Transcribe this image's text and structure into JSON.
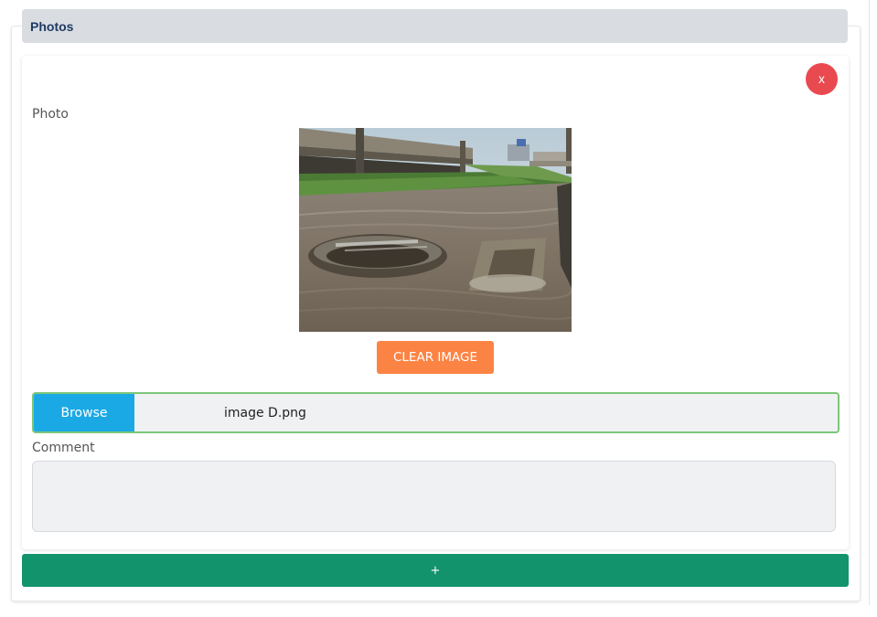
{
  "section": {
    "title": "Photos"
  },
  "photo_entry": {
    "remove_label": "x",
    "photo_label": "Photo",
    "clear_label": "CLEAR IMAGE",
    "browse_label": "Browse",
    "file_name": "image D.png",
    "comment_label": "Comment",
    "comment_value": ""
  },
  "add_label": "+",
  "colors": {
    "header_bg": "#d9dde2",
    "header_text": "#1f3b63",
    "remove": "#e94a4f",
    "clear": "#fb8445",
    "browse": "#1ba9e5",
    "file_border": "#7cc67a",
    "add": "#13936c"
  }
}
